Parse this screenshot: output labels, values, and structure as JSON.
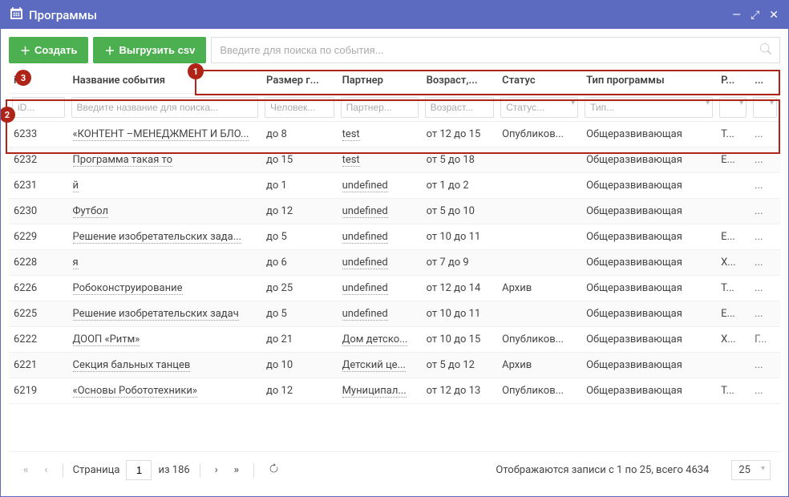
{
  "window": {
    "title": "Программы"
  },
  "toolbar": {
    "create": "Создать",
    "export": "Выгрузить csv",
    "search_placeholder": "Введите для поиска по события..."
  },
  "callouts": [
    "1",
    "2",
    "3"
  ],
  "columns": {
    "id": "iD",
    "name": "Название события",
    "size": "Размер г...",
    "partner": "Партнер",
    "age": "Возраст,...",
    "status": "Статус",
    "type": "Тип программы",
    "r": "Р...",
    "more": "..."
  },
  "filters": {
    "id": "iD...",
    "name": "Введите название для поиска...",
    "size": "Человек...",
    "partner": "Партнер...",
    "age": "Возраст...",
    "status": "Статус...",
    "type": "Тип..."
  },
  "rows": [
    {
      "id": "6233",
      "name": "«КОНТЕНТ –МЕНЕДЖМЕНТ И БЛО...",
      "size": "до 8",
      "partner": "test",
      "age": "от 12 до 15",
      "status": "Опубликов...",
      "type": "Общеразвивающая",
      "r": "Т...",
      "m": "..."
    },
    {
      "id": "6232",
      "name": "Программа такая то",
      "size": "до 15",
      "partner": "test",
      "age": "от 5 до 18",
      "status": "",
      "type": "Общеразвивающая",
      "r": "Е...",
      "m": "..."
    },
    {
      "id": "6231",
      "name": "й",
      "size": "до 1",
      "partner": "undefined",
      "age": "от 1 до 2",
      "status": "",
      "type": "Общеразвивающая",
      "r": "",
      "m": "..."
    },
    {
      "id": "6230",
      "name": "Футбол",
      "size": "до 12",
      "partner": "undefined",
      "age": "от 5 до 10",
      "status": "",
      "type": "Общеразвивающая",
      "r": "",
      "m": "..."
    },
    {
      "id": "6229",
      "name": "Решение изобретательских зада...",
      "size": "до 5",
      "partner": "undefined",
      "age": "от 10 до 11",
      "status": "",
      "type": "Общеразвивающая",
      "r": "Е...",
      "m": "..."
    },
    {
      "id": "6228",
      "name": "я",
      "size": "до 6",
      "partner": "undefined",
      "age": "от 7 до 9",
      "status": "",
      "type": "Общеразвивающая",
      "r": "Х...",
      "m": "..."
    },
    {
      "id": "6226",
      "name": "Робоконструирование",
      "size": "до 25",
      "partner": "undefined",
      "age": "от 12 до 14",
      "status": "Архив",
      "type": "Общеразвивающая",
      "r": "Т...",
      "m": "..."
    },
    {
      "id": "6225",
      "name": "Решение изобретательских задач",
      "size": "до 5",
      "partner": "undefined",
      "age": "от 10 до 11",
      "status": "",
      "type": "Общеразвивающая",
      "r": "Е...",
      "m": "..."
    },
    {
      "id": "6222",
      "name": "ДООП «Ритм»",
      "size": "до 21",
      "partner": "Дом детско...",
      "age": "от 10 до 15",
      "status": "Опубликов...",
      "type": "Общеразвивающая",
      "r": "Х...",
      "m": "Г..."
    },
    {
      "id": "6221",
      "name": "Секция бальных танцев",
      "size": "до 10",
      "partner": "Детский це...",
      "age": "от 5 до 12",
      "status": "Архив",
      "type": "Общеразвивающая",
      "r": "",
      "m": "..."
    },
    {
      "id": "6219",
      "name": "«Основы Робототехники»",
      "size": "до 12",
      "partner": "Муниципал...",
      "age": "от 12 до 13",
      "status": "Опубликов...",
      "type": "Общеразвивающая",
      "r": "Т...",
      "m": "..."
    }
  ],
  "pager": {
    "page_label": "Страница",
    "page": "1",
    "of": "из 186",
    "display": "Отображаются записи с 1 по 25, всего 4634",
    "page_size": "25"
  }
}
